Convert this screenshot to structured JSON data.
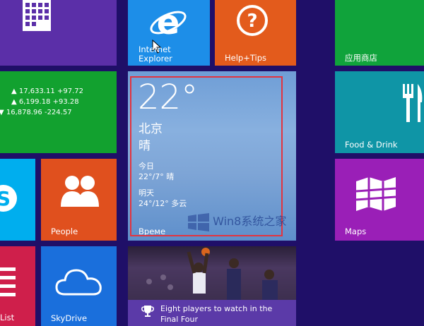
{
  "tiles": {
    "ie": {
      "label": "Internet Explorer"
    },
    "help": {
      "label": "Help+Tips"
    },
    "store": {
      "label": "应用商店"
    },
    "finance": {
      "rows": [
        {
          "arrow": "▲",
          "text": "17,633.11 +97.72"
        },
        {
          "arrow": "▲",
          "text": "6,199.18 +93.28"
        },
        {
          "arrow": "▼",
          "text": "16,878.96 -224.57"
        }
      ]
    },
    "weather": {
      "temp": "22°",
      "city": "北京",
      "condition": "晴",
      "today_label": "今日",
      "today_forecast": "22°/7° 晴",
      "tomorrow_label": "明天",
      "tomorrow_forecast": "24°/12° 多云",
      "label": "Време"
    },
    "food": {
      "label": "Food & Drink"
    },
    "people": {
      "label": "People"
    },
    "maps": {
      "label": "Maps"
    },
    "list": {
      "label": "List"
    },
    "skydrive": {
      "label": "SkyDrive"
    },
    "sports": {
      "caption": "Eight players to watch in the Final Four"
    }
  },
  "watermark": "Win8系统之家"
}
